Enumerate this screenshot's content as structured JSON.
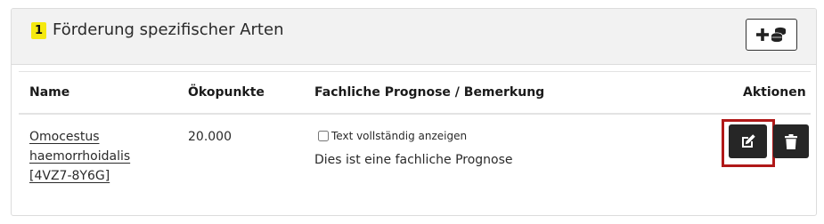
{
  "section": {
    "number": "1",
    "title": "Förderung spezifischer Arten",
    "add_icon": "plus-coins-icon"
  },
  "table": {
    "columns": {
      "name": "Name",
      "points": "Ökopunkte",
      "prognosis": "Fachliche Prognose / Bemerkung",
      "actions": "Aktionen"
    },
    "rows": [
      {
        "name": "Omocestus haemorrhoidalis [4VZ7-8Y6G]",
        "points": "20.000",
        "toggle_label": "Text vollständig anzeigen",
        "toggle_checked": false,
        "prognosis": "Dies ist eine fachliche Prognose",
        "edit_icon": "edit-icon",
        "delete_icon": "trash-icon"
      }
    ]
  },
  "colors": {
    "badge": "#f5e90f",
    "header_bg": "#f2f2f2",
    "action_button": "#262626",
    "highlight": "#b01818"
  }
}
